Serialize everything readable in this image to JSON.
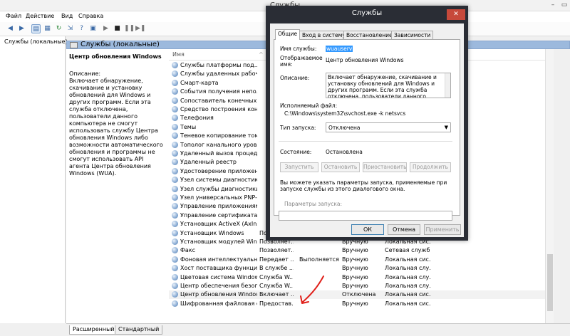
{
  "window": {
    "title": "Службы"
  },
  "menu": [
    "Файл",
    "Действие",
    "Вид",
    "Справка"
  ],
  "tree": {
    "root": "Службы (локальные)"
  },
  "header": {
    "title": "Службы (локальные)"
  },
  "details": {
    "service_title": "Центр обновления Windows",
    "description_label": "Описание:",
    "description": "Включает обнаружение, скачивание и установку обновлений для Windows и других программ. Если эта служба отключена, пользователи данного компьютера не смогут использовать службу Центра обновления Windows либо возможности автоматического обновления и программы не смогут использовать API агента Центра обновления Windows (WUA)."
  },
  "columns": {
    "name": "Имя"
  },
  "rows": [
    {
      "name": "Службы платформы под...",
      "desc": "",
      "state": "",
      "startup": "",
      "logon": ""
    },
    {
      "name": "Службы удаленных рабоч...",
      "desc": "",
      "state": "",
      "startup": "",
      "logon": ""
    },
    {
      "name": "Смарт-карта",
      "desc": "",
      "state": "",
      "startup": "",
      "logon": ""
    },
    {
      "name": "События получения непо...",
      "desc": "",
      "state": "",
      "startup": "",
      "logon": ""
    },
    {
      "name": "Сопоставитель конечных ...",
      "desc": "",
      "state": "",
      "startup": "",
      "logon": ""
    },
    {
      "name": "Средство построения коне...",
      "desc": "",
      "state": "",
      "startup": "",
      "logon": ""
    },
    {
      "name": "Телефония",
      "desc": "",
      "state": "",
      "startup": "",
      "logon": ""
    },
    {
      "name": "Темы",
      "desc": "",
      "state": "",
      "startup": "",
      "logon": ""
    },
    {
      "name": "Теневое копирование тома",
      "desc": "",
      "state": "",
      "startup": "",
      "logon": ""
    },
    {
      "name": "Тополог канального уровня",
      "desc": "",
      "state": "",
      "startup": "",
      "logon": ""
    },
    {
      "name": "Удаленный вызов процедур...",
      "desc": "",
      "state": "",
      "startup": "",
      "logon": ""
    },
    {
      "name": "Удаленный реестр",
      "desc": "",
      "state": "",
      "startup": "",
      "logon": ""
    },
    {
      "name": "Удостоверение приложения",
      "desc": "",
      "state": "",
      "startup": "",
      "logon": ""
    },
    {
      "name": "Узел системы диагностики",
      "desc": "",
      "state": "",
      "startup": "",
      "logon": ""
    },
    {
      "name": "Узел службы диагностики",
      "desc": "",
      "state": "",
      "startup": "",
      "logon": ""
    },
    {
      "name": "Узел универсальных PNP-...",
      "desc": "",
      "state": "",
      "startup": "",
      "logon": ""
    },
    {
      "name": "Управление приложениями",
      "desc": "",
      "state": "",
      "startup": "",
      "logon": ""
    },
    {
      "name": "Управление сертификатами...",
      "desc": "",
      "state": "",
      "startup": "",
      "logon": ""
    },
    {
      "name": "Установщик ActiveX (AxIns...",
      "desc": "",
      "state": "",
      "startup": "",
      "logon": ""
    },
    {
      "name": "Установщик Windows",
      "desc": "Позволяет...",
      "state": "",
      "startup": "Вручную",
      "logon": "Локальная сис..."
    },
    {
      "name": "Установщик модулей Windo...",
      "desc": "Позволяет...",
      "state": "",
      "startup": "Вручную",
      "logon": "Локальная сис..."
    },
    {
      "name": "Факс",
      "desc": "Позволяет...",
      "state": "",
      "startup": "Вручную",
      "logon": "Сетевая служба"
    },
    {
      "name": "Фоновая интеллектуальн...",
      "desc": "Передает ...",
      "state": "Выполняется",
      "startup": "Вручную",
      "logon": "Локальная сис..."
    },
    {
      "name": "Хост поставщика функции...",
      "desc": "В службе ...",
      "state": "",
      "startup": "Вручную",
      "logon": "Локальная слу..."
    },
    {
      "name": "Цветовая система Windows",
      "desc": "Служба W...",
      "state": "",
      "startup": "Вручную",
      "logon": "Локальная слу..."
    },
    {
      "name": "Центр обеспечения безоп...",
      "desc": "Служба W...",
      "state": "",
      "startup": "Вручную",
      "logon": "Локальная слу..."
    },
    {
      "name": "Центр обновления Windows",
      "desc": "Включает ...",
      "state": "",
      "startup": "Отключена",
      "logon": "Локальная сис..."
    },
    {
      "name": "Шифрованная файловая с...",
      "desc": "Предостав...",
      "state": "",
      "startup": "Вручную",
      "logon": "Локальная сис..."
    }
  ],
  "view_tabs": [
    "Расширенный",
    "Стандартный"
  ],
  "dialog": {
    "title": "Службы",
    "close": "✕",
    "tabs": [
      "Общие",
      "Вход в систему",
      "Восстановление",
      "Зависимости"
    ],
    "service_name_label": "Имя службы:",
    "service_name": "wuauserv",
    "display_name_label": "Отображаемое имя:",
    "display_name": "Центр обновления Windows",
    "description_label": "Описание:",
    "description": "Включает обнаружение, скачивание и установку обновлений для Windows и других программ. Если эта служба отключена, пользователи данного",
    "exe_label": "Исполняемый файл:",
    "exe_path": "C:\\Windows\\system32\\svchost.exe -k netsvcs",
    "startup_label": "Тип запуска:",
    "startup_value": "Отключена",
    "state_label": "Состояние:",
    "state_value": "Остановлена",
    "buttons": [
      "Запустить",
      "Остановить",
      "Приостановить",
      "Продолжить"
    ],
    "hint": "Вы можете указать параметры запуска, применяемые при запуске службы из этого диалогового окна.",
    "params_label": "Параметры запуска:",
    "ok": "ОК",
    "cancel": "Отмена",
    "apply": "Применить"
  },
  "colors": {
    "header_bg": "#9cb9dd",
    "dialog_frame": "#2a2d35",
    "close_red": "#c7493b",
    "annotation_red": "#e0201a"
  }
}
